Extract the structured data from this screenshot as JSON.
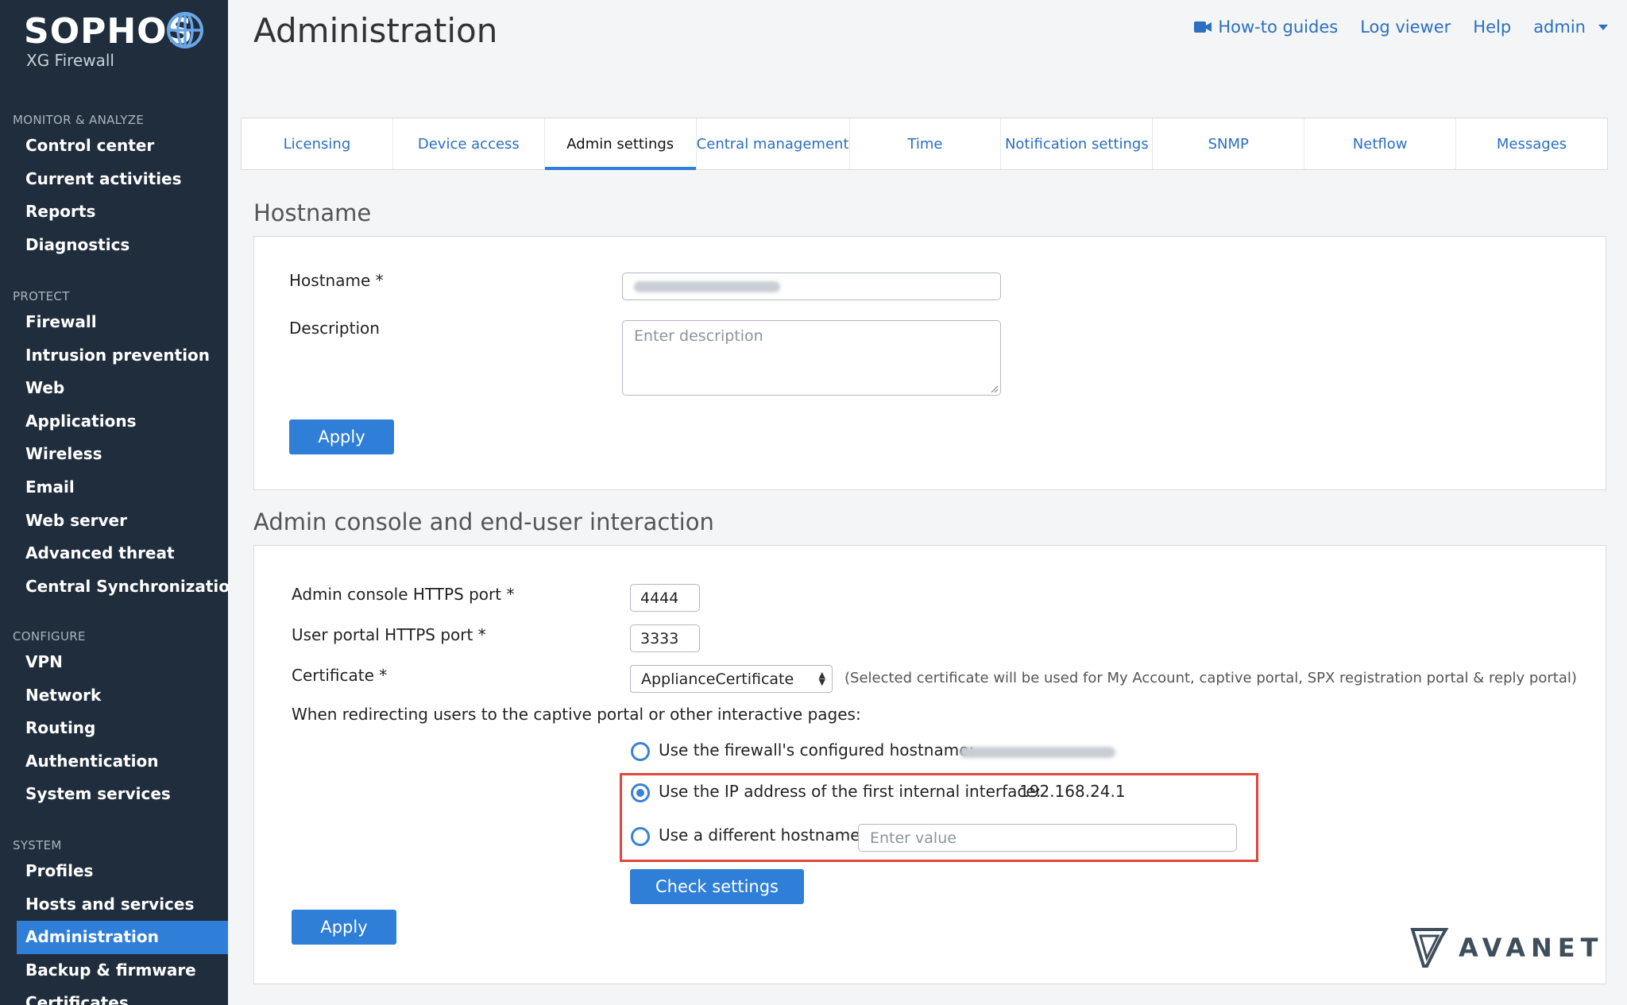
{
  "brand": {
    "name": "SOPHOS",
    "product": "XG Firewall"
  },
  "sidebar": {
    "sections": [
      {
        "heading": "MONITOR & ANALYZE",
        "items": [
          "Control center",
          "Current activities",
          "Reports",
          "Diagnostics"
        ]
      },
      {
        "heading": "PROTECT",
        "items": [
          "Firewall",
          "Intrusion prevention",
          "Web",
          "Applications",
          "Wireless",
          "Email",
          "Web server",
          "Advanced threat",
          "Central Synchronization"
        ]
      },
      {
        "heading": "CONFIGURE",
        "items": [
          "VPN",
          "Network",
          "Routing",
          "Authentication",
          "System services"
        ]
      },
      {
        "heading": "SYSTEM",
        "items": [
          "Profiles",
          "Hosts and services",
          "Administration",
          "Backup & firmware",
          "Certificates"
        ]
      }
    ],
    "active_item": "Administration"
  },
  "header": {
    "title": "Administration",
    "links": {
      "guides": "How-to guides",
      "log_viewer": "Log viewer",
      "help": "Help",
      "user": "admin"
    }
  },
  "tabs": [
    "Licensing",
    "Device access",
    "Admin settings",
    "Central management",
    "Time",
    "Notification settings",
    "SNMP",
    "Netflow",
    "Messages"
  ],
  "active_tab": "Admin settings",
  "hostname_section": {
    "title": "Hostname",
    "hostname_label": "Hostname *",
    "description_label": "Description",
    "description_placeholder": "Enter description",
    "apply_label": "Apply"
  },
  "admin_console_section": {
    "title": "Admin console and end-user interaction",
    "https_port_label": "Admin console HTTPS port *",
    "https_port_value": "4444",
    "user_portal_label": "User portal HTTPS port *",
    "user_portal_value": "3333",
    "certificate_label": "Certificate *",
    "certificate_value": "ApplianceCertificate",
    "certificate_note": "(Selected certificate will be used for My Account, captive portal, SPX registration portal & reply portal)",
    "redirect_text": "When redirecting users to the captive portal or other interactive pages:",
    "option_hostname": "Use the firewall's configured hostname:",
    "option_ip": "Use the IP address of the first internal interface:",
    "option_ip_value": "192.168.24.1",
    "option_different": "Use a different hostname:",
    "different_placeholder": "Enter value",
    "selected_option": "ip",
    "check_settings_label": "Check settings",
    "apply_label": "Apply"
  },
  "watermark": {
    "text": "AVANET"
  },
  "colors": {
    "sidebar": "#1f2d3d",
    "accent": "#2f7ed8",
    "link": "#2a6fc0",
    "highlight": "#e0463c"
  }
}
